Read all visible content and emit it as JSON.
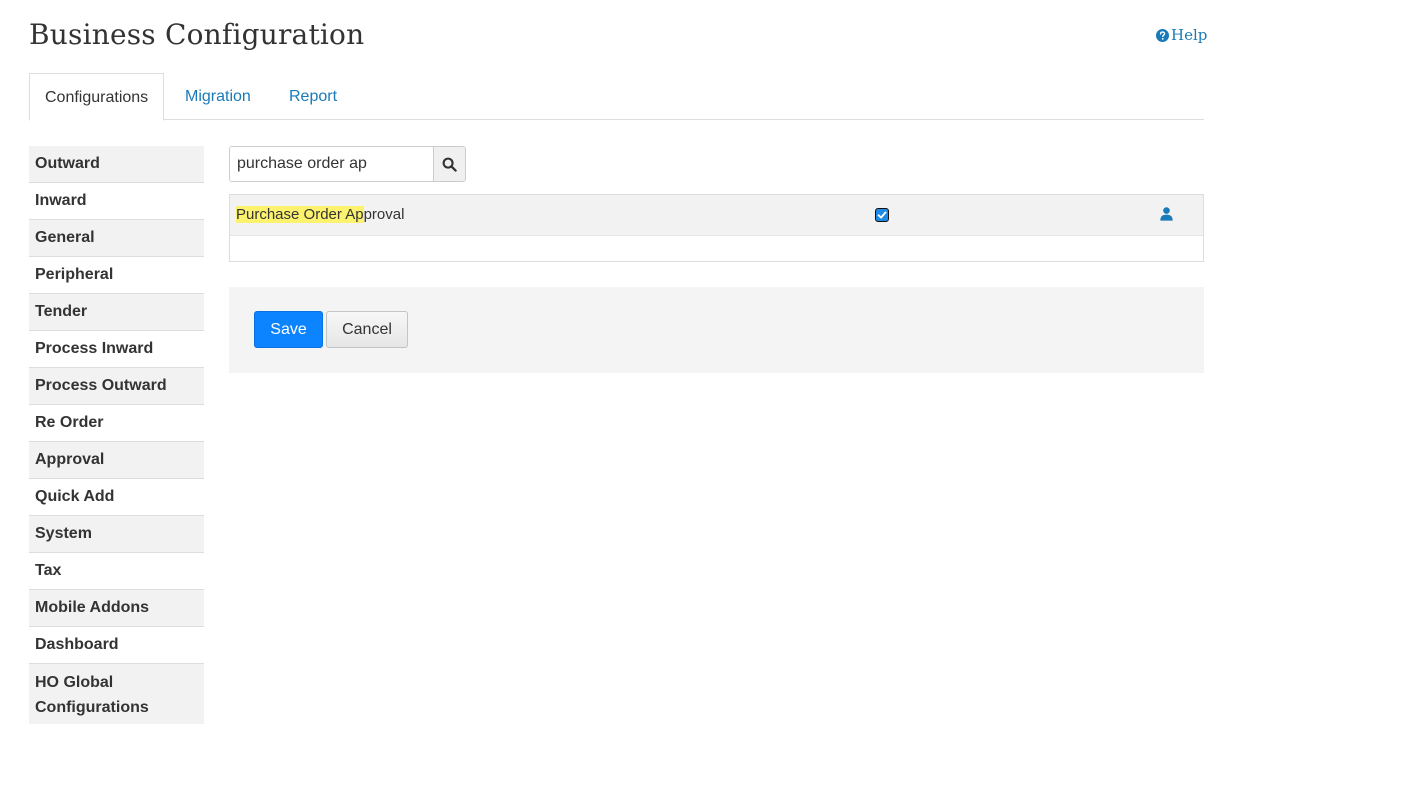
{
  "header": {
    "title": "Business Configuration",
    "help_label": "Help"
  },
  "tabs": [
    {
      "label": "Configurations",
      "active": true
    },
    {
      "label": "Migration",
      "active": false
    },
    {
      "label": "Report",
      "active": false
    }
  ],
  "sidebar": {
    "items": [
      {
        "label": "Outward"
      },
      {
        "label": "Inward"
      },
      {
        "label": "General"
      },
      {
        "label": "Peripheral"
      },
      {
        "label": "Tender"
      },
      {
        "label": "Process Inward"
      },
      {
        "label": "Process Outward"
      },
      {
        "label": "Re Order"
      },
      {
        "label": "Approval"
      },
      {
        "label": "Quick Add"
      },
      {
        "label": "System"
      },
      {
        "label": "Tax"
      },
      {
        "label": "Mobile Addons"
      },
      {
        "label": "Dashboard"
      },
      {
        "label": "HO Global Configurations"
      }
    ]
  },
  "search": {
    "value": "purchase order ap",
    "icon": "search-icon"
  },
  "results": [
    {
      "label_highlight": "Purchase Order Ap",
      "label_rest": "proval",
      "checked": true,
      "icon": "user-icon"
    }
  ],
  "actions": {
    "save_label": "Save",
    "cancel_label": "Cancel"
  },
  "colors": {
    "accent": "#0d84ff",
    "link": "#1a7ab8",
    "highlight": "#fcf26e"
  }
}
